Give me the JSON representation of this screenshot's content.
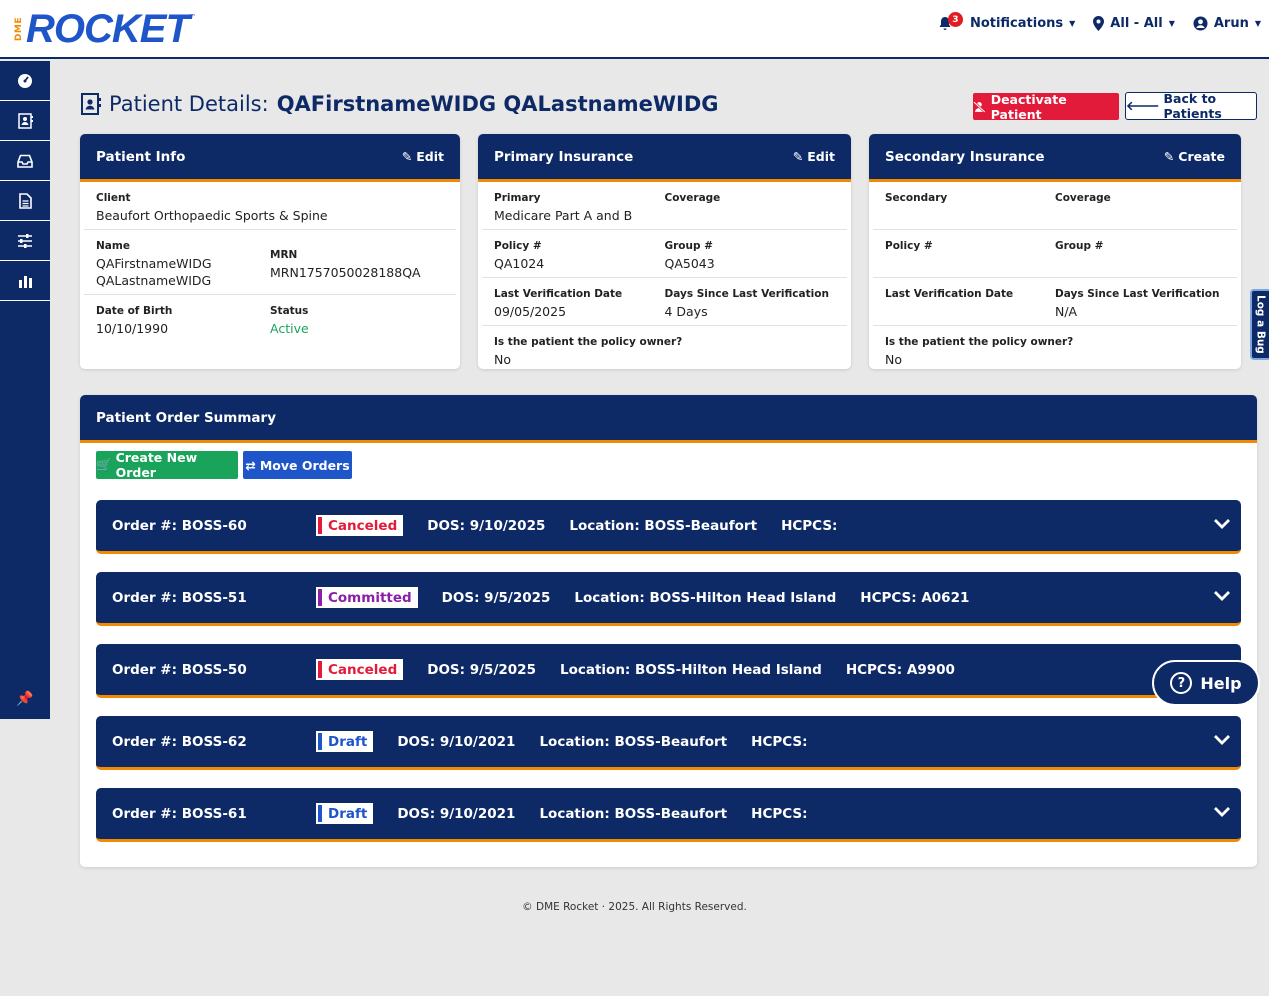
{
  "logo": {
    "prefix": "DME",
    "word": "ROCKET",
    "tm": "™"
  },
  "topnav": {
    "notifications_label": "Notifications",
    "notifications_count": "3",
    "location_label": "All - All",
    "user_label": "Arun"
  },
  "page": {
    "title_prefix": "Patient Details:",
    "patient_name": "QAFirstnameWIDG QALastnameWIDG",
    "deactivate_label": "Deactivate Patient",
    "back_label": "Back to Patients"
  },
  "patient_info": {
    "title": "Patient Info",
    "action": "Edit",
    "client_label": "Client",
    "client": "Beaufort Orthopaedic Sports & Spine",
    "name_label": "Name",
    "name_first": "QAFirstnameWIDG",
    "name_last": "QALastnameWIDG",
    "mrn_label": "MRN",
    "mrn": "MRN1757050028188QA",
    "dob_label": "Date of Birth",
    "dob": "10/10/1990",
    "status_label": "Status",
    "status": "Active"
  },
  "primary_insurance": {
    "title": "Primary Insurance",
    "action": "Edit",
    "primary_label": "Primary",
    "primary": "Medicare Part A and B",
    "coverage_label": "Coverage",
    "coverage": "",
    "policy_label": "Policy #",
    "policy": "QA1024",
    "group_label": "Group #",
    "group": "QA5043",
    "lvd_label": "Last Verification Date",
    "lvd": "09/05/2025",
    "days_label": "Days Since Last Verification",
    "days": "4 Days",
    "owner_label": "Is the patient the policy owner?",
    "owner": "No"
  },
  "secondary_insurance": {
    "title": "Secondary Insurance",
    "action": "Create",
    "secondary_label": "Secondary",
    "secondary": "",
    "coverage_label": "Coverage",
    "coverage": "",
    "policy_label": "Policy #",
    "policy": "",
    "group_label": "Group #",
    "group": "",
    "lvd_label": "Last Verification Date",
    "lvd": "",
    "days_label": "Days Since Last Verification",
    "days": "N/A",
    "owner_label": "Is the patient the policy owner?",
    "owner": "No"
  },
  "order_summary": {
    "title": "Patient Order Summary",
    "create_label": "Create New Order",
    "move_label": "Move Orders",
    "orders": [
      {
        "number": "Order #: BOSS-60",
        "status": "Canceled",
        "dos": "DOS: 9/10/2025",
        "location": "Location: BOSS-Beaufort",
        "hcpcs": "HCPCS:"
      },
      {
        "number": "Order #: BOSS-51",
        "status": "Committed",
        "dos": "DOS: 9/5/2025",
        "location": "Location: BOSS-Hilton Head Island",
        "hcpcs": "HCPCS: A0621"
      },
      {
        "number": "Order #: BOSS-50",
        "status": "Canceled",
        "dos": "DOS: 9/5/2025",
        "location": "Location: BOSS-Hilton Head Island",
        "hcpcs": "HCPCS: A9900"
      },
      {
        "number": "Order #: BOSS-62",
        "status": "Draft",
        "dos": "DOS: 9/10/2021",
        "location": "Location: BOSS-Beaufort",
        "hcpcs": "HCPCS:"
      },
      {
        "number": "Order #: BOSS-61",
        "status": "Draft",
        "dos": "DOS: 9/10/2021",
        "location": "Location: BOSS-Beaufort",
        "hcpcs": "HCPCS:"
      }
    ]
  },
  "help_label": "Help",
  "logbug_label": "Log a Bug",
  "footer": "© DME Rocket  ·  2025. All Rights Reserved.",
  "colors": {
    "navy": "#0d2a66",
    "accent": "#f08a00",
    "canceled": "#e31b3b",
    "committed": "#8a1fa8",
    "draft": "#1e55c8",
    "active": "#1aa35a"
  }
}
